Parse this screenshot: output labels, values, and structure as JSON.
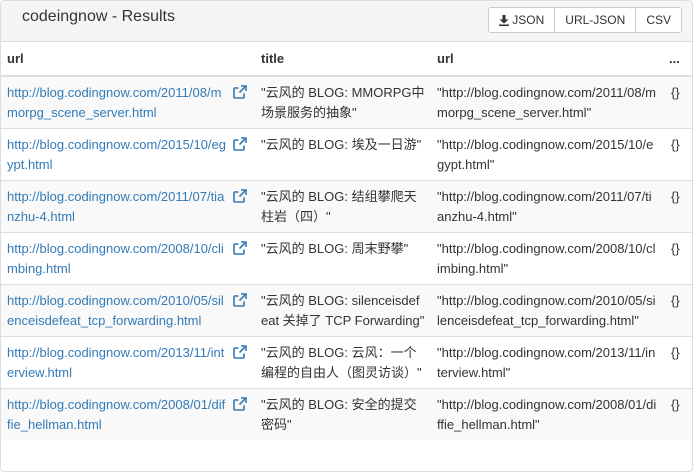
{
  "panel": {
    "title": "codeingnow - Results"
  },
  "toolbar": {
    "json_label": "JSON",
    "url_json_label": "URL-JSON",
    "csv_label": "CSV"
  },
  "table": {
    "headers": [
      "url",
      "title",
      "url",
      "..."
    ],
    "rows": [
      {
        "url": "http://blog.codingnow.com/2011/08/mmorpg_scene_server.html",
        "title": "\"云风的 BLOG: MMORPG中场景服务的抽象\"",
        "url2": "\"http://blog.codingnow.com/2011/08/mmorpg_scene_server.html\"",
        "obj": "{}"
      },
      {
        "url": "http://blog.codingnow.com/2015/10/egypt.html",
        "title": "\"云风的 BLOG: 埃及一日游\"",
        "url2": "\"http://blog.codingnow.com/2015/10/egypt.html\"",
        "obj": "{}"
      },
      {
        "url": "http://blog.codingnow.com/2011/07/tianzhu-4.html",
        "title": "\"云风的 BLOG: 结组攀爬天柱岩（四）\"",
        "url2": "\"http://blog.codingnow.com/2011/07/tianzhu-4.html\"",
        "obj": "{}"
      },
      {
        "url": "http://blog.codingnow.com/2008/10/climbing.html",
        "title": "\"云风的 BLOG: 周末野攀\"",
        "url2": "\"http://blog.codingnow.com/2008/10/climbing.html\"",
        "obj": "{}"
      },
      {
        "url": "http://blog.codingnow.com/2010/05/silenceisdefeat_tcp_forwarding.html",
        "title": "\"云风的 BLOG: silenceisdefeat 关掉了 TCP Forwarding\"",
        "url2": "\"http://blog.codingnow.com/2010/05/silenceisdefeat_tcp_forwarding.html\"",
        "obj": "{}"
      },
      {
        "url": "http://blog.codingnow.com/2013/11/interview.html",
        "title": "\"云风的 BLOG: 云风：一个编程的自由人（图灵访谈）\"",
        "url2": "\"http://blog.codingnow.com/2013/11/interview.html\"",
        "obj": "{}"
      },
      {
        "url": "http://blog.codingnow.com/2008/01/diffie_hellman.html",
        "title": "\"云风的 BLOG: 安全的提交密码\"",
        "url2": "\"http://blog.codingnow.com/2008/01/diffie_hellman.html\"",
        "obj": "{}"
      }
    ]
  },
  "colors": {
    "link": "#337ab7",
    "header_bg": "#f5f5f5",
    "stripe": "#f9f9f9",
    "border": "#dddddd"
  },
  "icons": {
    "download": "download-icon",
    "external_link": "external-link-icon"
  }
}
